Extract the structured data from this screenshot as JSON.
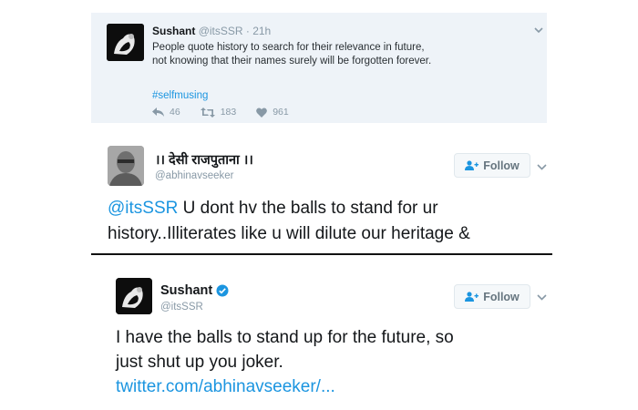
{
  "tweet1": {
    "name": "Sushant",
    "meta": "@itsSSR · 21h",
    "line1": "People quote history to search for their relevance in future,",
    "line2": "not knowing that their names surely will be forgotten forever.",
    "hashtag": "#selfmusing",
    "replies": "46",
    "retweets": "183",
    "likes": "961"
  },
  "tweet2": {
    "name": "।। देसी राजपुताना ।।",
    "handle": "@abhinavseeker",
    "follow_label": "Follow",
    "mention": "@itsSSR",
    "text": " U dont hv the balls to stand for ur history..Illiterates like u will dilute our heritage &"
  },
  "tweet3": {
    "name": "Sushant",
    "handle": "@itsSSR",
    "follow_label": "Follow",
    "line1": "I have the balls to stand up for the future, so",
    "line2": "just shut up you joker.",
    "link": "twitter.com/abhinavseeker/..."
  },
  "colors": {
    "link": "#1b95e0",
    "muted": "#8899a6",
    "tweet1_bg": "#eef3f8"
  },
  "icons": [
    "reply-icon",
    "retweet-icon",
    "heart-icon",
    "chevron-down-icon",
    "follow-person-icon",
    "verified-badge-icon"
  ]
}
